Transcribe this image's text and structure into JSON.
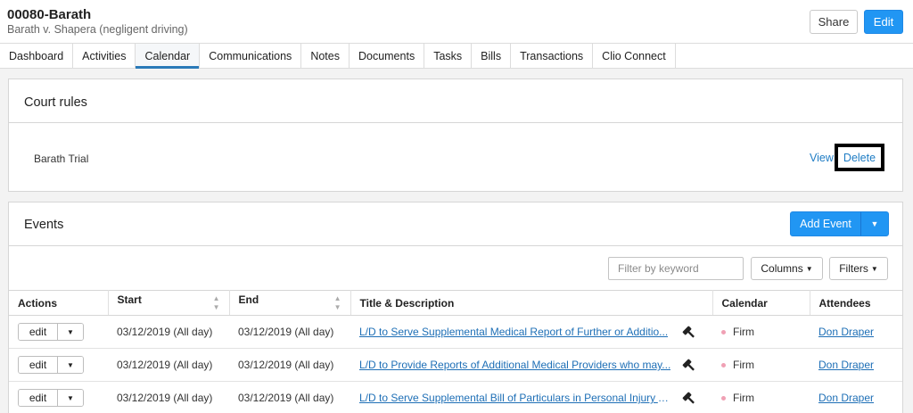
{
  "matter": {
    "title": "00080-Barath",
    "subtitle": "Barath v. Shapera (negligent driving)"
  },
  "header_actions": {
    "share_label": "Share",
    "edit_label": "Edit"
  },
  "tabs": [
    {
      "label": "Dashboard",
      "active": false
    },
    {
      "label": "Activities",
      "active": false
    },
    {
      "label": "Calendar",
      "active": true
    },
    {
      "label": "Communications",
      "active": false
    },
    {
      "label": "Notes",
      "active": false
    },
    {
      "label": "Documents",
      "active": false
    },
    {
      "label": "Tasks",
      "active": false
    },
    {
      "label": "Bills",
      "active": false
    },
    {
      "label": "Transactions",
      "active": false
    },
    {
      "label": "Clio Connect",
      "active": false
    }
  ],
  "court_rules": {
    "title": "Court rules",
    "item_name": "Barath Trial",
    "view_label": "View",
    "delete_label": "Delete"
  },
  "events": {
    "title": "Events",
    "add_event_label": "Add Event",
    "filter_placeholder": "Filter by keyword",
    "columns_label": "Columns",
    "filters_label": "Filters",
    "columns": [
      "Actions",
      "Start",
      "End",
      "Title & Description",
      "Calendar",
      "Attendees"
    ],
    "row_action_label": "edit",
    "rows": [
      {
        "start": "03/12/2019 (All day)",
        "end": "03/12/2019 (All day)",
        "title": "L/D to Serve Supplemental Medical Report of Further or Additio...",
        "calendar": "Firm",
        "attendee": "Don Draper"
      },
      {
        "start": "03/12/2019 (All day)",
        "end": "03/12/2019 (All day)",
        "title": "L/D to Provide Reports of Additional Medical Providers who may...",
        "calendar": "Firm",
        "attendee": "Don Draper"
      },
      {
        "start": "03/12/2019 (All day)",
        "end": "03/12/2019 (All day)",
        "title": "L/D to Serve Supplemental Bill of Particulars in Personal Injury A...",
        "calendar": "Firm",
        "attendee": "Don Draper"
      }
    ]
  },
  "colors": {
    "primary": "#2196f3",
    "link": "#1e6fb6",
    "calendar_dot": "#f0a0b4"
  }
}
